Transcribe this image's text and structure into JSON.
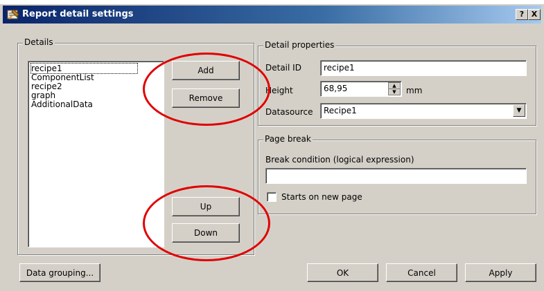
{
  "window": {
    "title": "Report detail settings",
    "help_label": "?",
    "close_label": "X"
  },
  "details_group": {
    "label": "Details",
    "items": [
      {
        "label": "recipe1",
        "selected": true
      },
      {
        "label": "ComponentList",
        "selected": false
      },
      {
        "label": "recipe2",
        "selected": false
      },
      {
        "label": "graph",
        "selected": false
      },
      {
        "label": "AdditionalData",
        "selected": false
      }
    ],
    "add_label": "Add",
    "remove_label": "Remove",
    "up_label": "Up",
    "down_label": "Down"
  },
  "detail_properties": {
    "label": "Detail properties",
    "detail_id_label": "Detail ID",
    "detail_id_value": "recipe1",
    "height_label": "Height",
    "height_value": "68,95",
    "height_unit": "mm",
    "datasource_label": "Datasource",
    "datasource_value": "Recipe1"
  },
  "page_break": {
    "label": "Page break",
    "break_condition_label": "Break condition (logical expression)",
    "break_condition_value": "",
    "starts_new_page_label": "Starts on new page",
    "starts_new_page_checked": false
  },
  "footer": {
    "data_grouping_label": "Data grouping...",
    "ok_label": "OK",
    "cancel_label": "Cancel",
    "apply_label": "Apply"
  },
  "annotation_color": "#e00000"
}
